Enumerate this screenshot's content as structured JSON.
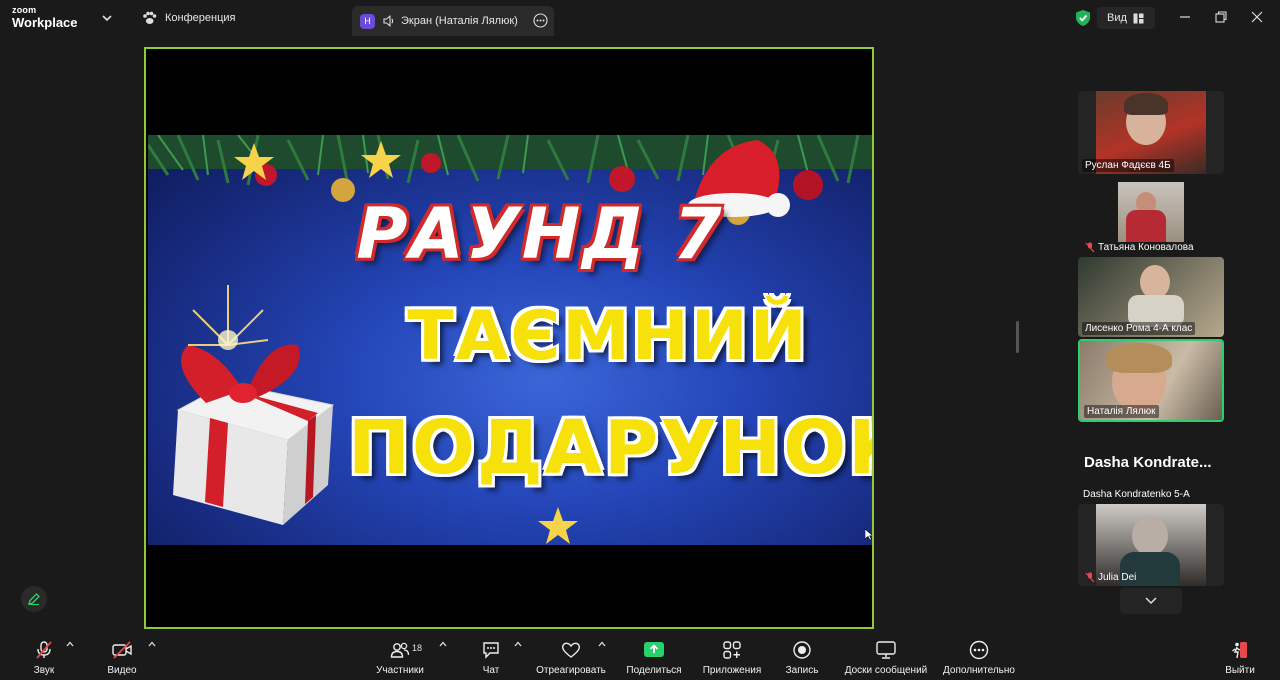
{
  "app": {
    "brand_line1": "zoom",
    "brand_line2": "Workplace"
  },
  "topbar": {
    "conference_label": "Конференция",
    "tab_badge": "H",
    "tab_label": "Экран (Наталія Лялюк)",
    "view_label": "Вид"
  },
  "slide": {
    "line1": "РАУНД 7",
    "line2": "ТАЄМНИЙ",
    "line3": "ПОДАРУНОК"
  },
  "participants": [
    {
      "name": "Руслан Фадєєв 4Б",
      "muted": false
    },
    {
      "name": "Татьяна Коновалова",
      "muted": true
    },
    {
      "name": "Лисенко Рома 4-А клас",
      "muted": false
    },
    {
      "name": "Наталія Лялюк",
      "muted": false,
      "active": true
    },
    {
      "name": "Julia Dei",
      "muted": true
    }
  ],
  "dasha": {
    "title": "Dasha  Kondrate...",
    "name": "Dasha Kondratenko 5-А"
  },
  "toolbar": {
    "audio": "Звук",
    "video": "Видео",
    "participants": "Участники",
    "participants_count": "18",
    "chat": "Чат",
    "react": "Отреагировать",
    "share": "Поделиться",
    "apps": "Приложения",
    "record": "Запись",
    "whiteboards": "Доски сообщений",
    "more": "Дополнительно",
    "leave": "Выйти"
  },
  "colors": {
    "share_border": "#8fc93a",
    "share_button": "#2ad06c",
    "active_speaker": "#2ad06c",
    "leave": "#e5484d"
  }
}
